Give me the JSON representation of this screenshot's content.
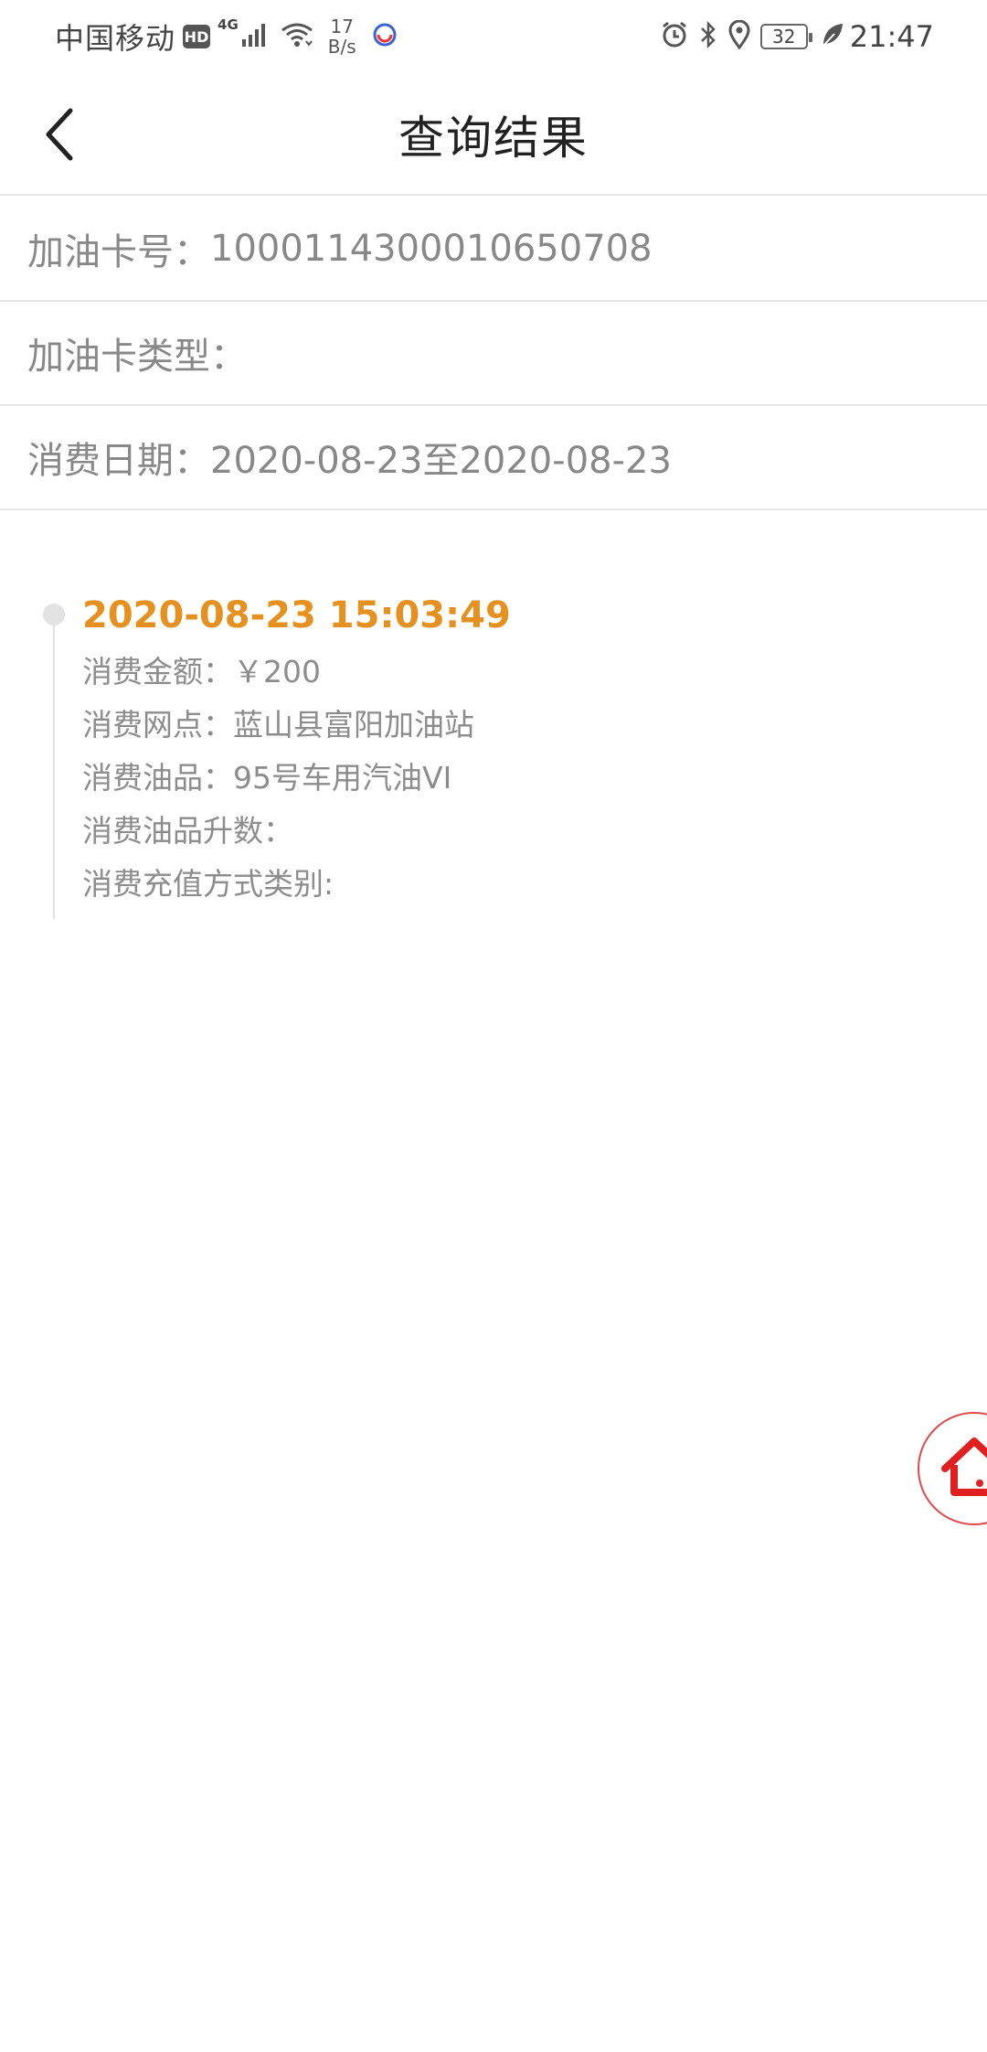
{
  "status_bar": {
    "carrier": "中国移动",
    "hd_label": "HD",
    "network_type": "4G",
    "speed_value": "17",
    "speed_unit": "B/s",
    "battery_level": "32",
    "time": "21:47",
    "icons": [
      "signal-icon",
      "wifi-icon",
      "app-dot-icon",
      "alarm-icon",
      "bluetooth-icon",
      "location-icon",
      "battery-icon",
      "leaf-icon"
    ]
  },
  "nav": {
    "title": "查询结果",
    "back_icon": "chevron-left-icon"
  },
  "info": {
    "card_number_label": "加油卡号：",
    "card_number_value": "1000114300010650708",
    "card_type_label": "加油卡类型：",
    "card_type_value": "",
    "date_label": "消费日期：",
    "date_value": "2020-08-23至2020-08-23"
  },
  "records": [
    {
      "timestamp": "2020-08-23 15:03:49",
      "amount_line": "消费金额：￥200",
      "station_line": "消费网点：蓝山县富阳加油站",
      "product_line": "消费油品：95号车用汽油VI",
      "liters_line": "消费油品升数：",
      "payment_line": "消费充值方式类别:"
    }
  ],
  "colors": {
    "accent_orange": "#e5901f",
    "text_gray": "#888888",
    "divider": "#e6e6e6",
    "home_red": "#e02020"
  },
  "fab": {
    "icon": "home-icon"
  }
}
